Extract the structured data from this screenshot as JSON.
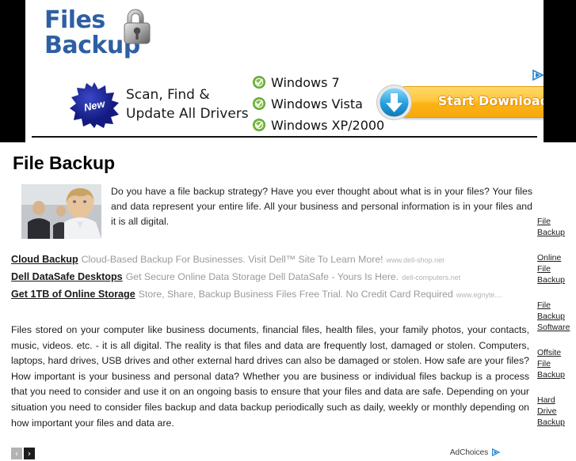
{
  "banner_ad": {
    "logo_line1": "Files",
    "logo_line2": "Backup",
    "logo_color": "#2e5fa3",
    "badge_label": "New",
    "tagline_line1": "Scan, Find &",
    "tagline_line2": "Update All Drivers",
    "os_items": [
      {
        "label": "Windows 7"
      },
      {
        "label": "Windows Vista"
      },
      {
        "label": "Windows XP/2000"
      }
    ],
    "download_button": "Start Download",
    "download_button_color": "#ffc63a",
    "adchoices_icon": "adchoices-triangle-icon"
  },
  "page": {
    "title": "File Backup",
    "intro_paragraph": "Do you have a file backup strategy? Have you ever thought about what is in your files? Your files and data represent your entire life. All your business and personal information is in your files and it is all digital.",
    "body_paragraph": "Files stored on your computer like business documents, financial files, health files, your family photos, your contacts, music, videos. etc. - it is all digital. The reality is that files and data are frequently lost, damaged or stolen. Computers, laptops, hard drives, USB drives and other external hard drives can also be damaged or stolen. How safe are your files? How important is your business and personal data? Whether you are business or individual files backup is a process that you need to consider and use it on an ongoing basis to ensure that your files and data are safe. Depending on your situation you need to consider files backup and data backup periodically such as daily, weekly or monthly depending on how important your files and data are.",
    "photo_name": "business-people-photo"
  },
  "sponsored": {
    "ads": [
      {
        "title": "Cloud Backup",
        "description": "Cloud-Based Backup For Businesses. Visit Dell™ Site To Learn More!",
        "url": "www.dell-shop.net"
      },
      {
        "title": "Dell DataSafe Desktops",
        "description": "Get Secure Online Data Storage Dell DataSafe - Yours Is Here.",
        "url": "dell-computers.net"
      },
      {
        "title": "Get 1TB of Online Storage",
        "description": "Store, Share, Backup Business Files Free Trial. No Credit Card Required",
        "url": "www.egnyte...."
      }
    ],
    "prev_label": "‹",
    "next_label": "›",
    "adchoices_label": "AdChoices"
  },
  "sidebar": {
    "links": [
      {
        "label": "File Backup"
      },
      {
        "label": "Online File Backup"
      },
      {
        "label": "File Backup Software"
      },
      {
        "label": "Offsite File Backup"
      },
      {
        "label": "Hard Drive Backup"
      }
    ]
  }
}
